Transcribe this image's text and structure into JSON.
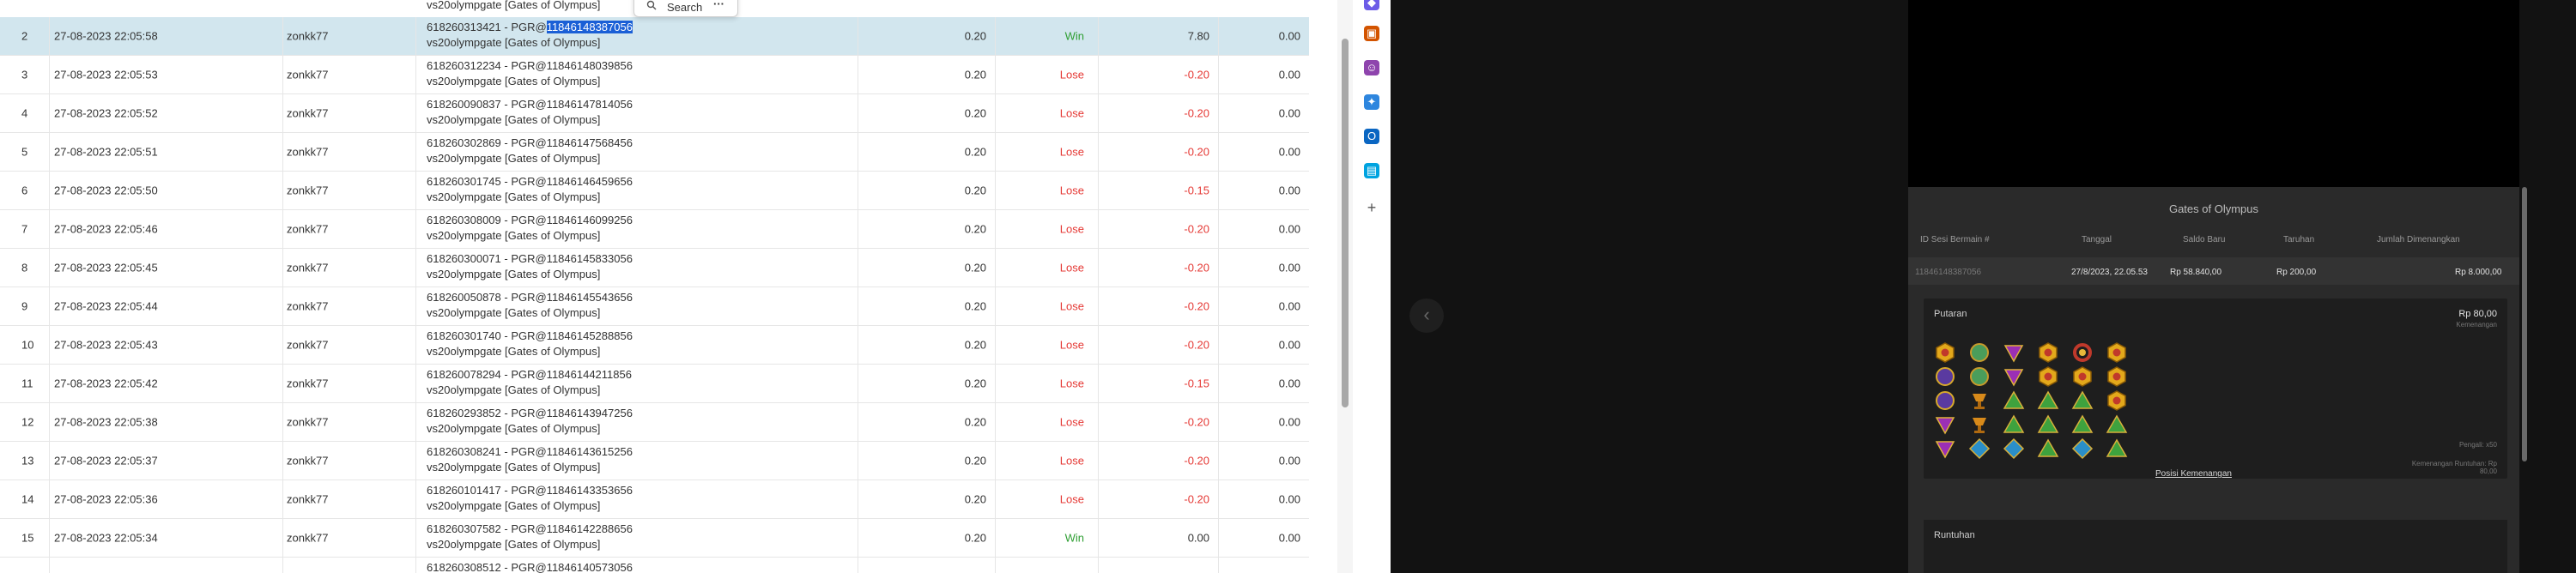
{
  "search_popup": {
    "label": "Search",
    "more": "···"
  },
  "top_row": {
    "game_line2": "vs20olympgate [Gates of Olympus]"
  },
  "rows": [
    {
      "no": "2",
      "date": "27-08-2023 22:05:58",
      "user": "zonkk77",
      "id_prefix": "618260313421 - PGR@",
      "id_hl": "11846148387056",
      "game": "vs20olympgate [Gates of Olympus]",
      "bet": "0.20",
      "result": "Win",
      "win": "7.80",
      "balance": "0.00"
    },
    {
      "no": "3",
      "date": "27-08-2023 22:05:53",
      "user": "zonkk77",
      "id_prefix": "618260312234 - PGR@11846148039856",
      "id_hl": "",
      "game": "vs20olympgate [Gates of Olympus]",
      "bet": "0.20",
      "result": "Lose",
      "win": "-0.20",
      "balance": "0.00"
    },
    {
      "no": "4",
      "date": "27-08-2023 22:05:52",
      "user": "zonkk77",
      "id_prefix": "618260090837 - PGR@11846147814056",
      "id_hl": "",
      "game": "vs20olympgate [Gates of Olympus]",
      "bet": "0.20",
      "result": "Lose",
      "win": "-0.20",
      "balance": "0.00"
    },
    {
      "no": "5",
      "date": "27-08-2023 22:05:51",
      "user": "zonkk77",
      "id_prefix": "618260302869 - PGR@11846147568456",
      "id_hl": "",
      "game": "vs20olympgate [Gates of Olympus]",
      "bet": "0.20",
      "result": "Lose",
      "win": "-0.20",
      "balance": "0.00"
    },
    {
      "no": "6",
      "date": "27-08-2023 22:05:50",
      "user": "zonkk77",
      "id_prefix": "618260301745 - PGR@11846146459656",
      "id_hl": "",
      "game": "vs20olympgate [Gates of Olympus]",
      "bet": "0.20",
      "result": "Lose",
      "win": "-0.15",
      "balance": "0.00"
    },
    {
      "no": "7",
      "date": "27-08-2023 22:05:46",
      "user": "zonkk77",
      "id_prefix": "618260308009 - PGR@11846146099256",
      "id_hl": "",
      "game": "vs20olympgate [Gates of Olympus]",
      "bet": "0.20",
      "result": "Lose",
      "win": "-0.20",
      "balance": "0.00"
    },
    {
      "no": "8",
      "date": "27-08-2023 22:05:45",
      "user": "zonkk77",
      "id_prefix": "618260300071 - PGR@11846145833056",
      "id_hl": "",
      "game": "vs20olympgate [Gates of Olympus]",
      "bet": "0.20",
      "result": "Lose",
      "win": "-0.20",
      "balance": "0.00"
    },
    {
      "no": "9",
      "date": "27-08-2023 22:05:44",
      "user": "zonkk77",
      "id_prefix": "618260050878 - PGR@11846145543656",
      "id_hl": "",
      "game": "vs20olympgate [Gates of Olympus]",
      "bet": "0.20",
      "result": "Lose",
      "win": "-0.20",
      "balance": "0.00"
    },
    {
      "no": "10",
      "date": "27-08-2023 22:05:43",
      "user": "zonkk77",
      "id_prefix": "618260301740 - PGR@11846145288856",
      "id_hl": "",
      "game": "vs20olympgate [Gates of Olympus]",
      "bet": "0.20",
      "result": "Lose",
      "win": "-0.20",
      "balance": "0.00"
    },
    {
      "no": "11",
      "date": "27-08-2023 22:05:42",
      "user": "zonkk77",
      "id_prefix": "618260078294 - PGR@11846144211856",
      "id_hl": "",
      "game": "vs20olympgate [Gates of Olympus]",
      "bet": "0.20",
      "result": "Lose",
      "win": "-0.15",
      "balance": "0.00"
    },
    {
      "no": "12",
      "date": "27-08-2023 22:05:38",
      "user": "zonkk77",
      "id_prefix": "618260293852 - PGR@11846143947256",
      "id_hl": "",
      "game": "vs20olympgate [Gates of Olympus]",
      "bet": "0.20",
      "result": "Lose",
      "win": "-0.20",
      "balance": "0.00"
    },
    {
      "no": "13",
      "date": "27-08-2023 22:05:37",
      "user": "zonkk77",
      "id_prefix": "618260308241 - PGR@11846143615256",
      "id_hl": "",
      "game": "vs20olympgate [Gates of Olympus]",
      "bet": "0.20",
      "result": "Lose",
      "win": "-0.20",
      "balance": "0.00"
    },
    {
      "no": "14",
      "date": "27-08-2023 22:05:36",
      "user": "zonkk77",
      "id_prefix": "618260101417 - PGR@11846143353656",
      "id_hl": "",
      "game": "vs20olympgate [Gates of Olympus]",
      "bet": "0.20",
      "result": "Lose",
      "win": "-0.20",
      "balance": "0.00"
    },
    {
      "no": "15",
      "date": "27-08-2023 22:05:34",
      "user": "zonkk77",
      "id_prefix": "618260307582 - PGR@11846142288656",
      "id_hl": "",
      "game": "vs20olympgate [Gates of Olympus]",
      "bet": "0.20",
      "result": "Win",
      "win": "0.00",
      "balance": "0.00"
    }
  ],
  "partial_bottom_row": {
    "id_prefix": "618260308512 - PGR@11846140573056"
  },
  "colors": {
    "lose": "#e53935",
    "win": "#2e9e32",
    "selected_row": "#d2e6ee",
    "highlight": "#1a5fd6"
  },
  "sidebar_icons": [
    "diamond-icon",
    "briefcase-icon",
    "people-icon",
    "copilot-icon",
    "outlook-icon",
    "store-icon",
    "plus-icon"
  ],
  "viewer": {
    "title": "Gates of Olympus",
    "headers": {
      "id": "ID Sesi Bermain #",
      "date": "Tanggal",
      "balance": "Saldo Baru",
      "bet": "Taruhan",
      "win": "Jumlah Dimenangkan"
    },
    "values": {
      "id": "11846148387056",
      "date": "27/8/2023, 22.05.53",
      "balance": "Rp 58.840,00",
      "bet": "Rp 200,00",
      "win": "Rp 8.000,00"
    },
    "spin_label": "Putaran",
    "spin_amount": "Rp 80,00",
    "spin_win_label": "Kemenangan",
    "multiplier_label": "Pengali: x50",
    "cascade_label": "Kemenangan Runtuhan: Rp 80,00",
    "win_positions_link": "Posisi Kemenangan",
    "cascade_section_label": "Runtuhan"
  }
}
